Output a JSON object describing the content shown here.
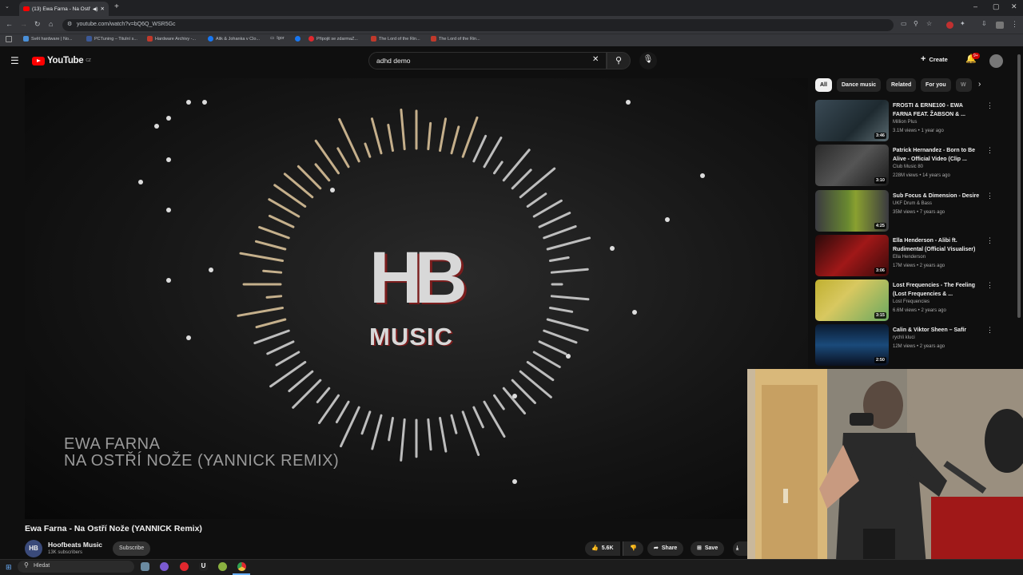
{
  "browser": {
    "tab_title": "(13) Ewa Farna - Na Ostří N",
    "url": "youtube.com/watch?v=bQ6Q_WSR5Gc",
    "bookmarks": [
      {
        "label": "Svět hardware | No...",
        "color": "#4a90d9"
      },
      {
        "label": "PCTuning – Titulní s...",
        "color": "#3b5998"
      },
      {
        "label": "Hardware Archivy -...",
        "color": "#c0392b"
      },
      {
        "label": "Alik & Johanka v Clo...",
        "color": "#1877f2"
      },
      {
        "label": "Igor",
        "color": "#f0c040"
      },
      {
        "label": "",
        "color": "#1877f2"
      },
      {
        "label": "Připojit se zdarmaZ...",
        "color": "#e0282e"
      },
      {
        "label": "The Lord of the Rin...",
        "color": "#c0392b"
      },
      {
        "label": "The Lord of the Rin...",
        "color": "#c0392b"
      }
    ]
  },
  "youtube": {
    "logo_text": "YouTube",
    "logo_country": "CZ",
    "search_value": "adhd demo",
    "create_label": "Create",
    "notification_count": "9+"
  },
  "video": {
    "logo_main": "HB",
    "logo_sub": "MUSIC",
    "overlay_line1": "EWA FARNA",
    "overlay_line2": "NA OSTŘÍ NOŽE (YANNICK REMIX)",
    "title": "Ewa Farna - Na Ostří Nože (YANNICK Remix)",
    "channel_initials": "HB",
    "channel_name": "Hoofbeats Music",
    "channel_subs": "13K subscribers",
    "subscribe_label": "Subscribe",
    "likes": "5.6K",
    "share_label": "Share",
    "save_label": "Save"
  },
  "chips": [
    "All",
    "Dance music",
    "Related",
    "For you",
    "W"
  ],
  "recommendations": [
    {
      "title": "FROSTI & ERNE100 - EWA FARNA FEAT. ŽABSON & ...",
      "channel": "Million Plus",
      "meta": "3.1M views • 1 year ago",
      "duration": "3:46",
      "bg": "linear-gradient(135deg,#3a4a55,#1e2a30 60%,#5a6a70)"
    },
    {
      "title": "Patrick Hernandez - Born to Be Alive - Official Video (Clip ...",
      "channel": "Club Music 80",
      "meta": "228M views • 14 years ago",
      "duration": "3:10",
      "bg": "linear-gradient(135deg,#2a2a2a,#555 50%,#1a1a1a)"
    },
    {
      "title": "Sub Focus & Dimension - Desire",
      "channel": "UKF Drum & Bass",
      "meta": "35M views • 7 years ago",
      "duration": "4:25",
      "bg": "linear-gradient(90deg,#3a3a40,#6a8a30 45%,#8aa030 55%,#3a3a40)"
    },
    {
      "title": "Ella Henderson - Alibi ft. Rudimental (Official Visualiser)",
      "channel": "Ella Henderson",
      "meta": "17M views • 2 years ago",
      "duration": "3:06",
      "bg": "linear-gradient(135deg,#2a0a0a,#a01818 50%,#3a0a0a)"
    },
    {
      "title": "Lost Frequencies - The Feeling (Lost Frequencies & ...",
      "channel": "Lost Frequencies",
      "meta": "6.6M views • 2 years ago",
      "duration": "3:15",
      "bg": "linear-gradient(135deg,#c0b030,#d8c860 40%,#6aa860)"
    },
    {
      "title": "Calin & Viktor Sheen – Safír",
      "channel": "rychli kluci",
      "meta": "12M views • 2 years ago",
      "duration": "2:50",
      "bg": "linear-gradient(180deg,#0a1a30,#1a4a7a 50%,#0a1020)"
    }
  ],
  "taskbar": {
    "search_placeholder": "Hledat"
  }
}
